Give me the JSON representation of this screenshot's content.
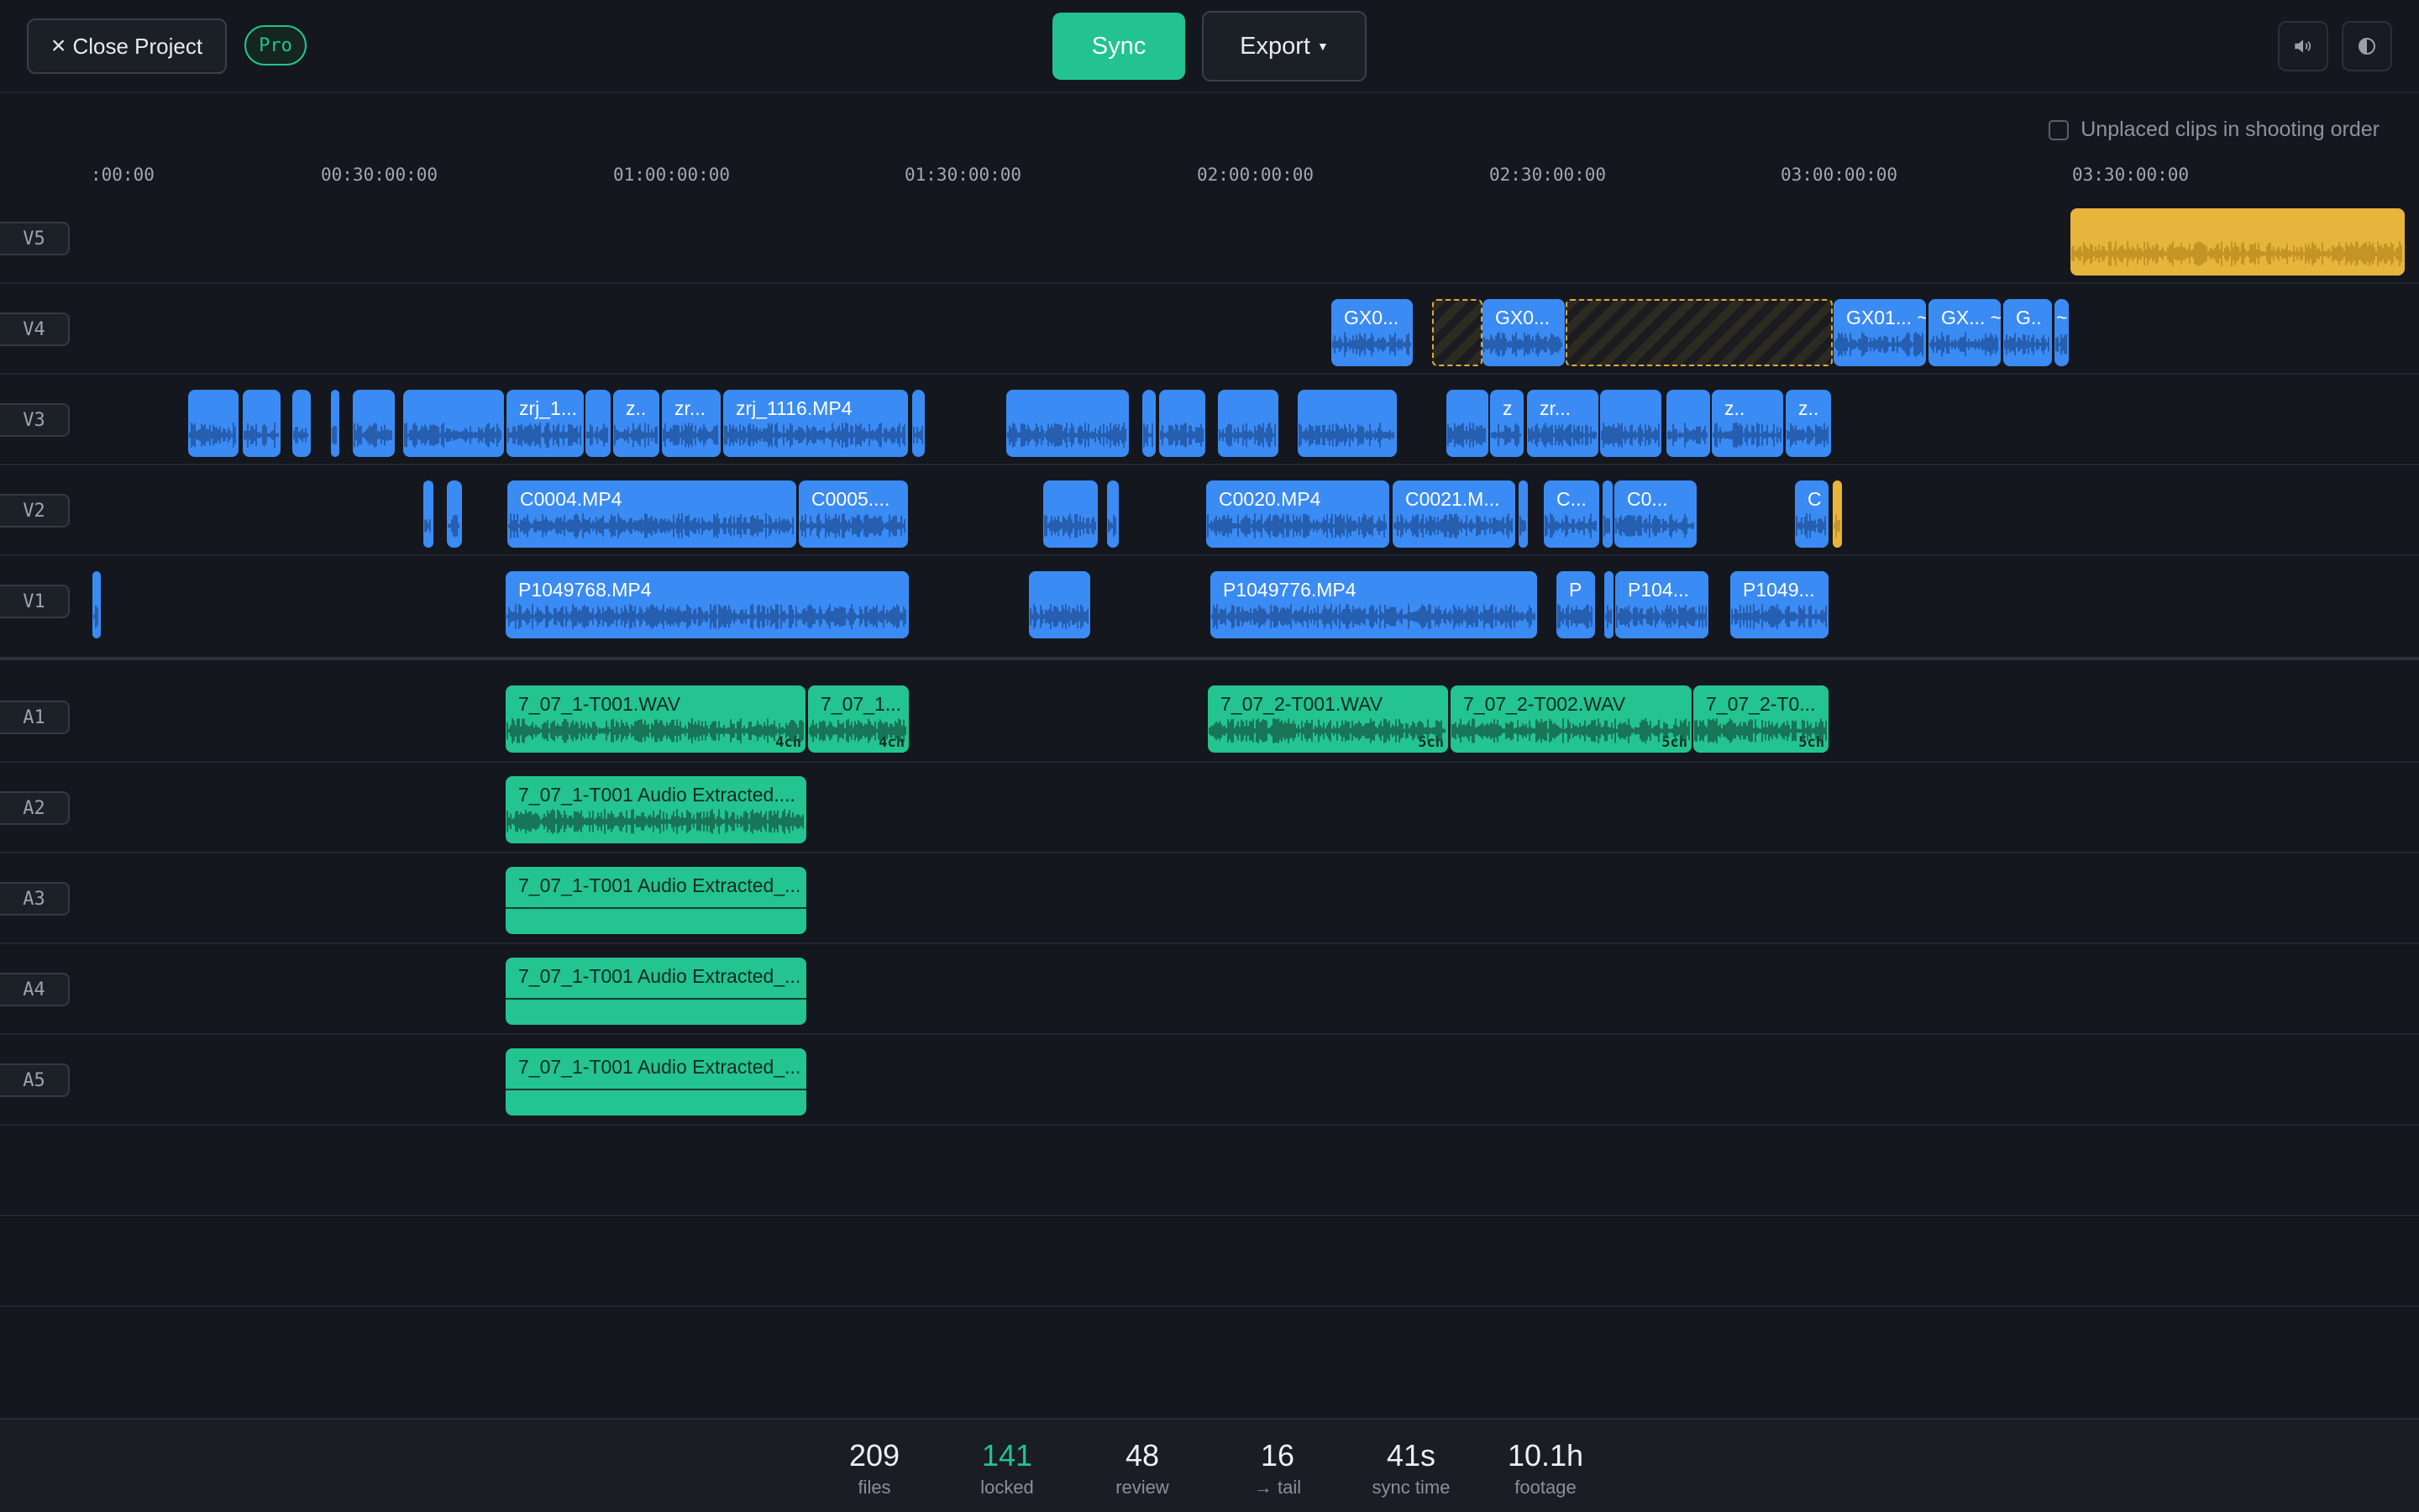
{
  "toolbar": {
    "close_label": "Close Project",
    "badge": "Pro",
    "sync_label": "Sync",
    "export_label": "Export",
    "icons": [
      "volume-icon",
      "contrast-icon"
    ]
  },
  "options": {
    "unplaced_label": "Unplaced clips in shooting order",
    "unplaced_checked": false
  },
  "ruler": {
    "ticks": [
      ":00:00",
      "00:30:00:00",
      "01:00:00:00",
      "01:30:00:00",
      "02:00:00:00",
      "02:30:00:00",
      "03:00:00:00",
      "03:30:00:00"
    ]
  },
  "tracks": {
    "v5": "V5",
    "v4": "V4",
    "v3": "V3",
    "v2": "V2",
    "v1": "V1",
    "a1": "A1",
    "a2": "A2",
    "a3": "A3",
    "a4": "A4",
    "a5": "A5"
  },
  "clips": {
    "v4_gx1": "GX0...",
    "v4_gx2": "GX0...",
    "v4_gx3": "GX01... ~",
    "v4_gx4": "GX... ~",
    "v4_gx5": "G..",
    "v4_gx6": "~",
    "v3_zrj1": "zrj_1...",
    "v3_z1": "z..",
    "v3_zr1": "zr...",
    "v3_zrj1116": "zrj_1116.MP4",
    "v3_z2": "z",
    "v3_zr2": "zr...",
    "v3_z3": "z..",
    "v3_z4": "z..",
    "v2_c0004": "C0004.MP4",
    "v2_c0005": "C0005....",
    "v2_c0020": "C0020.MP4",
    "v2_c0021": "C0021.M...",
    "v2_c1": "C...",
    "v2_c2": "C0...",
    "v2_c3": "C",
    "v1_p1049768": "P1049768.MP4",
    "v1_p1049776": "P1049776.MP4",
    "v1_p": "P",
    "v1_p104": "P104...",
    "v1_p1049": "P1049...",
    "a1_t001a": "7_07_1-T001.WAV",
    "a1_t001a_ch": "4ch",
    "a1_t001b": "7_07_1...",
    "a1_t001b_ch": "4ch",
    "a1_t001c": "7_07_2-T001.WAV",
    "a1_t001c_ch": "5ch",
    "a1_t002": "7_07_2-T002.WAV",
    "a1_t002_ch": "5ch",
    "a1_t0": "7_07_2-T0...",
    "a1_t0_ch": "5ch",
    "a2_ext": "7_07_1-T001 Audio Extracted....",
    "a3_ext": "7_07_1-T001 Audio Extracted_...",
    "a4_ext": "7_07_1-T001 Audio Extracted_...",
    "a5_ext": "7_07_1-T001 Audio Extracted_..."
  },
  "stats": [
    {
      "value": "209",
      "label": "files"
    },
    {
      "value": "141",
      "label": "locked"
    },
    {
      "value": "48",
      "label": "review"
    },
    {
      "value": "16",
      "label": "→ tail"
    },
    {
      "value": "41s",
      "label": "sync time"
    },
    {
      "value": "10.1h",
      "label": "footage"
    }
  ],
  "colors": {
    "video_clip": "#3b8bf4",
    "audio_clip": "#23c48f",
    "unplaced_clip": "#e7b53b",
    "accent": "#22c38e",
    "background": "#14171d"
  }
}
